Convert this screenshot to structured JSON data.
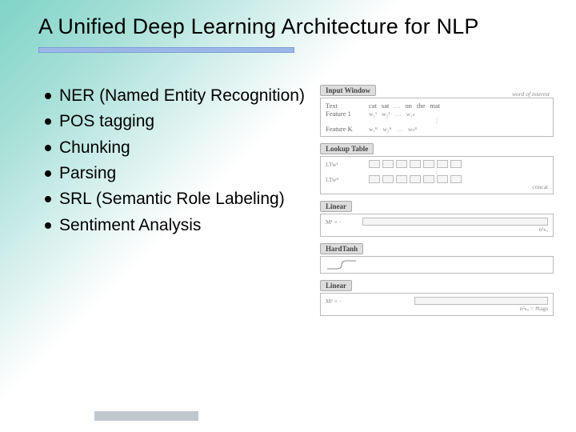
{
  "title": "A Unified Deep Learning Architecture for NLP",
  "bullets": [
    "NER (Named Entity Recognition)",
    "POS tagging",
    "Chunking",
    "Parsing",
    "SRL (Semantic Role Labeling)",
    "Sentiment Analysis"
  ],
  "diagram": {
    "layers": [
      "Input Window",
      "Lookup Table",
      "Linear",
      "HardTanh",
      "Linear"
    ],
    "input": {
      "wordOfInterest": "word of interest",
      "textLabel": "Text",
      "textTokens": [
        "cat",
        "sat",
        "on",
        "the",
        "mat"
      ],
      "feature1Label": "Feature 1",
      "feature1Tokens": [
        "w₁¹",
        "w₂¹",
        "…",
        "w₁ₙ"
      ],
      "featureKLabel": "Feature K",
      "featureKTokens": [
        "w₁ᴷ",
        "w₂ᴷ",
        "…",
        "wₙᴷ"
      ]
    },
    "lookup": {
      "lt1": "LTw¹",
      "ltk": "LTwᴷ",
      "concat": "concat"
    },
    "linear1": {
      "m": "M¹ × ·",
      "nhu": "n¹ₕᵤ"
    },
    "linear2": {
      "m": "M² × ·",
      "nhu": "n²ₕᵤ = #tags"
    }
  }
}
